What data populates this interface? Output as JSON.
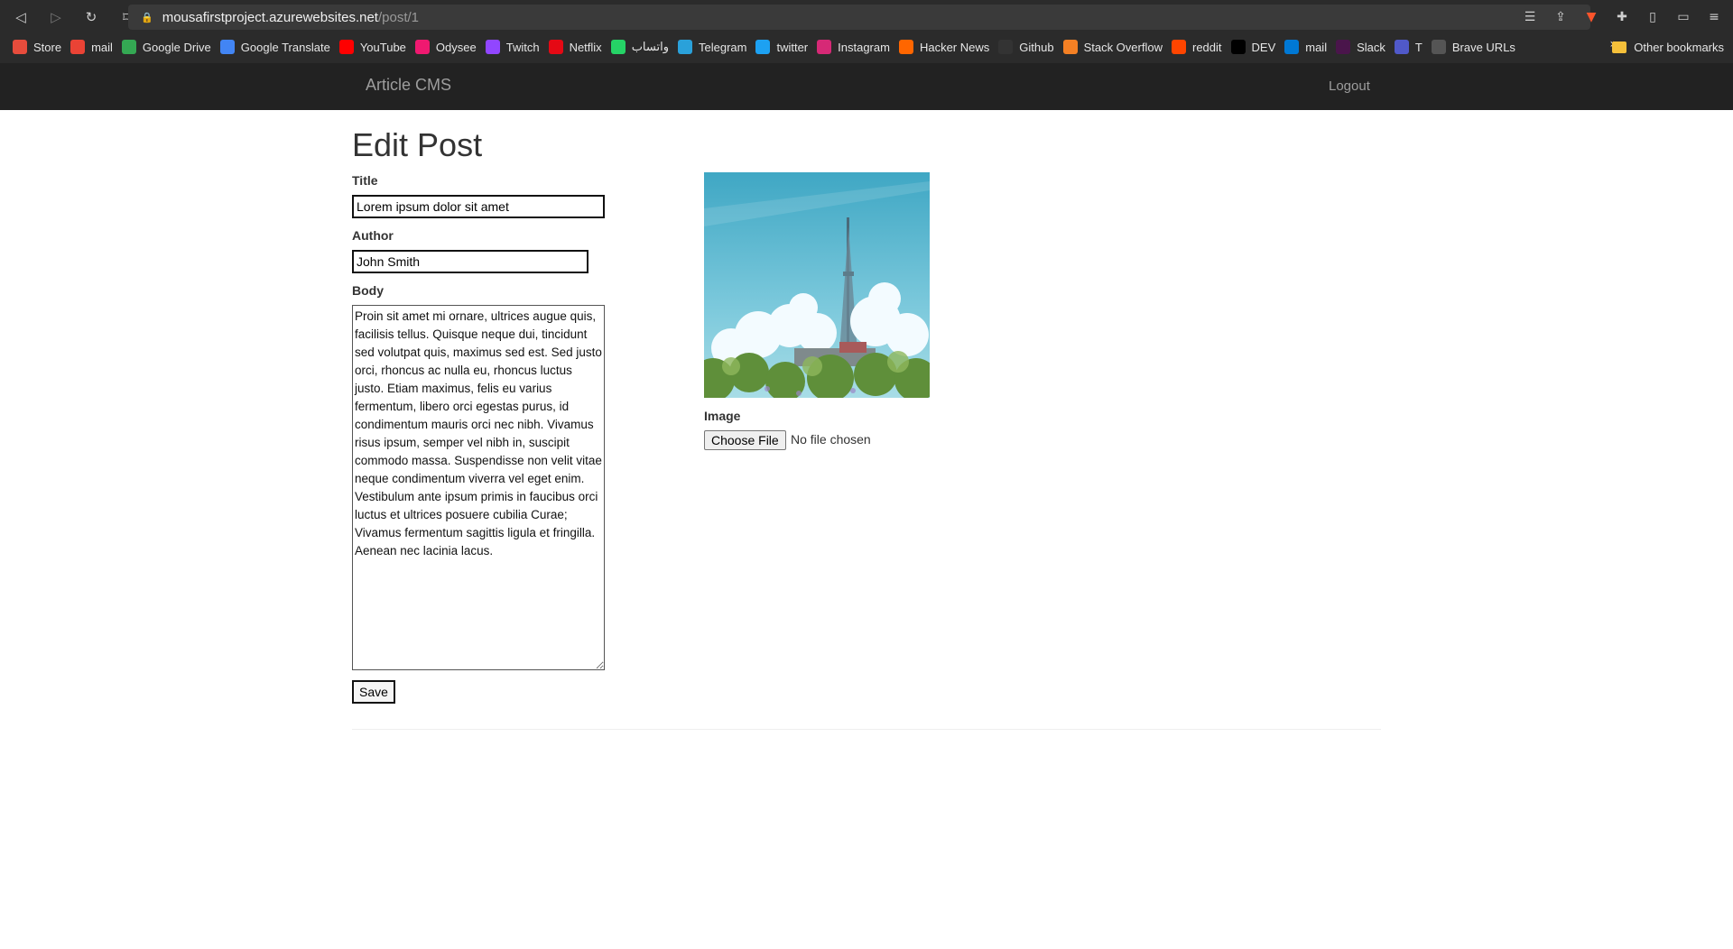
{
  "browser": {
    "url_host": "mousafirstproject.azurewebsites.net",
    "url_path": "/post/1",
    "bookmarks": [
      {
        "label": "Store",
        "icon": "store-icon",
        "color": "#e74c3c"
      },
      {
        "label": "mail",
        "icon": "gmail-icon",
        "color": "#ea4335"
      },
      {
        "label": "Google Drive",
        "icon": "drive-icon",
        "color": "#34a853"
      },
      {
        "label": "Google Translate",
        "icon": "translate-icon",
        "color": "#4285f4"
      },
      {
        "label": "YouTube",
        "icon": "youtube-icon",
        "color": "#ff0000"
      },
      {
        "label": "Odysee",
        "icon": "odysee-icon",
        "color": "#ef1970"
      },
      {
        "label": "Twitch",
        "icon": "twitch-icon",
        "color": "#9146ff"
      },
      {
        "label": "Netflix",
        "icon": "netflix-icon",
        "color": "#e50914"
      },
      {
        "label": "واتساب",
        "icon": "whatsapp-icon",
        "color": "#25d366"
      },
      {
        "label": "Telegram",
        "icon": "telegram-icon",
        "color": "#2aa1da"
      },
      {
        "label": "twitter",
        "icon": "twitter-icon",
        "color": "#1da1f2"
      },
      {
        "label": "Instagram",
        "icon": "instagram-icon",
        "color": "#d62976"
      },
      {
        "label": "Hacker News",
        "icon": "hackernews-icon",
        "color": "#ff6600"
      },
      {
        "label": "Github",
        "icon": "github-icon",
        "color": "#333333"
      },
      {
        "label": "Stack Overflow",
        "icon": "stackoverflow-icon",
        "color": "#f48024"
      },
      {
        "label": "reddit",
        "icon": "reddit-icon",
        "color": "#ff4500"
      },
      {
        "label": "DEV",
        "icon": "dev-icon",
        "color": "#000000"
      },
      {
        "label": "mail",
        "icon": "outlook-icon",
        "color": "#0078d4"
      },
      {
        "label": "Slack",
        "icon": "slack-icon",
        "color": "#4a154b"
      },
      {
        "label": "T",
        "icon": "teams-icon",
        "color": "#5059c9"
      },
      {
        "label": "Brave URLs",
        "icon": "globe-icon",
        "color": "#555555"
      }
    ],
    "other_bookmarks": "Other bookmarks"
  },
  "site": {
    "brand": "Article CMS",
    "logout": "Logout"
  },
  "form": {
    "heading": "Edit Post",
    "title_label": "Title",
    "title_value": "Lorem ipsum dolor sit amet",
    "author_label": "Author",
    "author_value": "John Smith",
    "body_label": "Body",
    "body_value": "Proin sit amet mi ornare, ultrices augue quis, facilisis tellus. Quisque neque dui, tincidunt sed volutpat quis, maximus sed est. Sed justo orci, rhoncus ac nulla eu, rhoncus luctus justo. Etiam maximus, felis eu varius fermentum, libero orci egestas purus, id condimentum mauris orci nec nibh. Vivamus risus ipsum, semper vel nibh in, suscipit commodo massa. Suspendisse non velit vitae neque condimentum viverra vel eget enim. Vestibulum ante ipsum primis in faucibus orci luctus et ultrices posuere cubilia Curae; Vivamus fermentum sagittis ligula et fringilla. Aenean nec lacinia lacus.",
    "save_label": "Save",
    "image_label": "Image",
    "choose_file_label": "Choose File",
    "file_status": "No file chosen"
  },
  "colors": {
    "navbar_bg": "#222222",
    "navbar_text": "#9d9d9d",
    "chrome_bg": "#2b2b2b"
  }
}
